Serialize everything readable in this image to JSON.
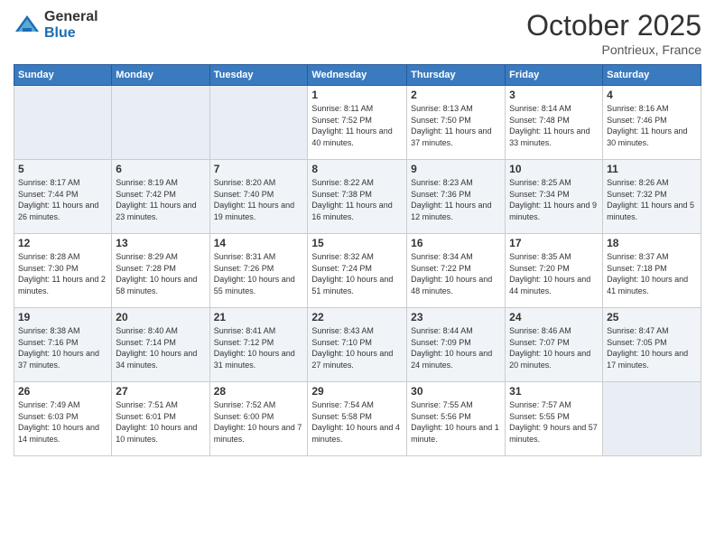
{
  "logo": {
    "general": "General",
    "blue": "Blue"
  },
  "header": {
    "month": "October 2025",
    "location": "Pontrieux, France"
  },
  "weekdays": [
    "Sunday",
    "Monday",
    "Tuesday",
    "Wednesday",
    "Thursday",
    "Friday",
    "Saturday"
  ],
  "weeks": [
    [
      {
        "day": "",
        "sunrise": "",
        "sunset": "",
        "daylight": ""
      },
      {
        "day": "",
        "sunrise": "",
        "sunset": "",
        "daylight": ""
      },
      {
        "day": "",
        "sunrise": "",
        "sunset": "",
        "daylight": ""
      },
      {
        "day": "1",
        "sunrise": "Sunrise: 8:11 AM",
        "sunset": "Sunset: 7:52 PM",
        "daylight": "Daylight: 11 hours and 40 minutes."
      },
      {
        "day": "2",
        "sunrise": "Sunrise: 8:13 AM",
        "sunset": "Sunset: 7:50 PM",
        "daylight": "Daylight: 11 hours and 37 minutes."
      },
      {
        "day": "3",
        "sunrise": "Sunrise: 8:14 AM",
        "sunset": "Sunset: 7:48 PM",
        "daylight": "Daylight: 11 hours and 33 minutes."
      },
      {
        "day": "4",
        "sunrise": "Sunrise: 8:16 AM",
        "sunset": "Sunset: 7:46 PM",
        "daylight": "Daylight: 11 hours and 30 minutes."
      }
    ],
    [
      {
        "day": "5",
        "sunrise": "Sunrise: 8:17 AM",
        "sunset": "Sunset: 7:44 PM",
        "daylight": "Daylight: 11 hours and 26 minutes."
      },
      {
        "day": "6",
        "sunrise": "Sunrise: 8:19 AM",
        "sunset": "Sunset: 7:42 PM",
        "daylight": "Daylight: 11 hours and 23 minutes."
      },
      {
        "day": "7",
        "sunrise": "Sunrise: 8:20 AM",
        "sunset": "Sunset: 7:40 PM",
        "daylight": "Daylight: 11 hours and 19 minutes."
      },
      {
        "day": "8",
        "sunrise": "Sunrise: 8:22 AM",
        "sunset": "Sunset: 7:38 PM",
        "daylight": "Daylight: 11 hours and 16 minutes."
      },
      {
        "day": "9",
        "sunrise": "Sunrise: 8:23 AM",
        "sunset": "Sunset: 7:36 PM",
        "daylight": "Daylight: 11 hours and 12 minutes."
      },
      {
        "day": "10",
        "sunrise": "Sunrise: 8:25 AM",
        "sunset": "Sunset: 7:34 PM",
        "daylight": "Daylight: 11 hours and 9 minutes."
      },
      {
        "day": "11",
        "sunrise": "Sunrise: 8:26 AM",
        "sunset": "Sunset: 7:32 PM",
        "daylight": "Daylight: 11 hours and 5 minutes."
      }
    ],
    [
      {
        "day": "12",
        "sunrise": "Sunrise: 8:28 AM",
        "sunset": "Sunset: 7:30 PM",
        "daylight": "Daylight: 11 hours and 2 minutes."
      },
      {
        "day": "13",
        "sunrise": "Sunrise: 8:29 AM",
        "sunset": "Sunset: 7:28 PM",
        "daylight": "Daylight: 10 hours and 58 minutes."
      },
      {
        "day": "14",
        "sunrise": "Sunrise: 8:31 AM",
        "sunset": "Sunset: 7:26 PM",
        "daylight": "Daylight: 10 hours and 55 minutes."
      },
      {
        "day": "15",
        "sunrise": "Sunrise: 8:32 AM",
        "sunset": "Sunset: 7:24 PM",
        "daylight": "Daylight: 10 hours and 51 minutes."
      },
      {
        "day": "16",
        "sunrise": "Sunrise: 8:34 AM",
        "sunset": "Sunset: 7:22 PM",
        "daylight": "Daylight: 10 hours and 48 minutes."
      },
      {
        "day": "17",
        "sunrise": "Sunrise: 8:35 AM",
        "sunset": "Sunset: 7:20 PM",
        "daylight": "Daylight: 10 hours and 44 minutes."
      },
      {
        "day": "18",
        "sunrise": "Sunrise: 8:37 AM",
        "sunset": "Sunset: 7:18 PM",
        "daylight": "Daylight: 10 hours and 41 minutes."
      }
    ],
    [
      {
        "day": "19",
        "sunrise": "Sunrise: 8:38 AM",
        "sunset": "Sunset: 7:16 PM",
        "daylight": "Daylight: 10 hours and 37 minutes."
      },
      {
        "day": "20",
        "sunrise": "Sunrise: 8:40 AM",
        "sunset": "Sunset: 7:14 PM",
        "daylight": "Daylight: 10 hours and 34 minutes."
      },
      {
        "day": "21",
        "sunrise": "Sunrise: 8:41 AM",
        "sunset": "Sunset: 7:12 PM",
        "daylight": "Daylight: 10 hours and 31 minutes."
      },
      {
        "day": "22",
        "sunrise": "Sunrise: 8:43 AM",
        "sunset": "Sunset: 7:10 PM",
        "daylight": "Daylight: 10 hours and 27 minutes."
      },
      {
        "day": "23",
        "sunrise": "Sunrise: 8:44 AM",
        "sunset": "Sunset: 7:09 PM",
        "daylight": "Daylight: 10 hours and 24 minutes."
      },
      {
        "day": "24",
        "sunrise": "Sunrise: 8:46 AM",
        "sunset": "Sunset: 7:07 PM",
        "daylight": "Daylight: 10 hours and 20 minutes."
      },
      {
        "day": "25",
        "sunrise": "Sunrise: 8:47 AM",
        "sunset": "Sunset: 7:05 PM",
        "daylight": "Daylight: 10 hours and 17 minutes."
      }
    ],
    [
      {
        "day": "26",
        "sunrise": "Sunrise: 7:49 AM",
        "sunset": "Sunset: 6:03 PM",
        "daylight": "Daylight: 10 hours and 14 minutes."
      },
      {
        "day": "27",
        "sunrise": "Sunrise: 7:51 AM",
        "sunset": "Sunset: 6:01 PM",
        "daylight": "Daylight: 10 hours and 10 minutes."
      },
      {
        "day": "28",
        "sunrise": "Sunrise: 7:52 AM",
        "sunset": "Sunset: 6:00 PM",
        "daylight": "Daylight: 10 hours and 7 minutes."
      },
      {
        "day": "29",
        "sunrise": "Sunrise: 7:54 AM",
        "sunset": "Sunset: 5:58 PM",
        "daylight": "Daylight: 10 hours and 4 minutes."
      },
      {
        "day": "30",
        "sunrise": "Sunrise: 7:55 AM",
        "sunset": "Sunset: 5:56 PM",
        "daylight": "Daylight: 10 hours and 1 minute."
      },
      {
        "day": "31",
        "sunrise": "Sunrise: 7:57 AM",
        "sunset": "Sunset: 5:55 PM",
        "daylight": "Daylight: 9 hours and 57 minutes."
      },
      {
        "day": "",
        "sunrise": "",
        "sunset": "",
        "daylight": ""
      }
    ]
  ]
}
